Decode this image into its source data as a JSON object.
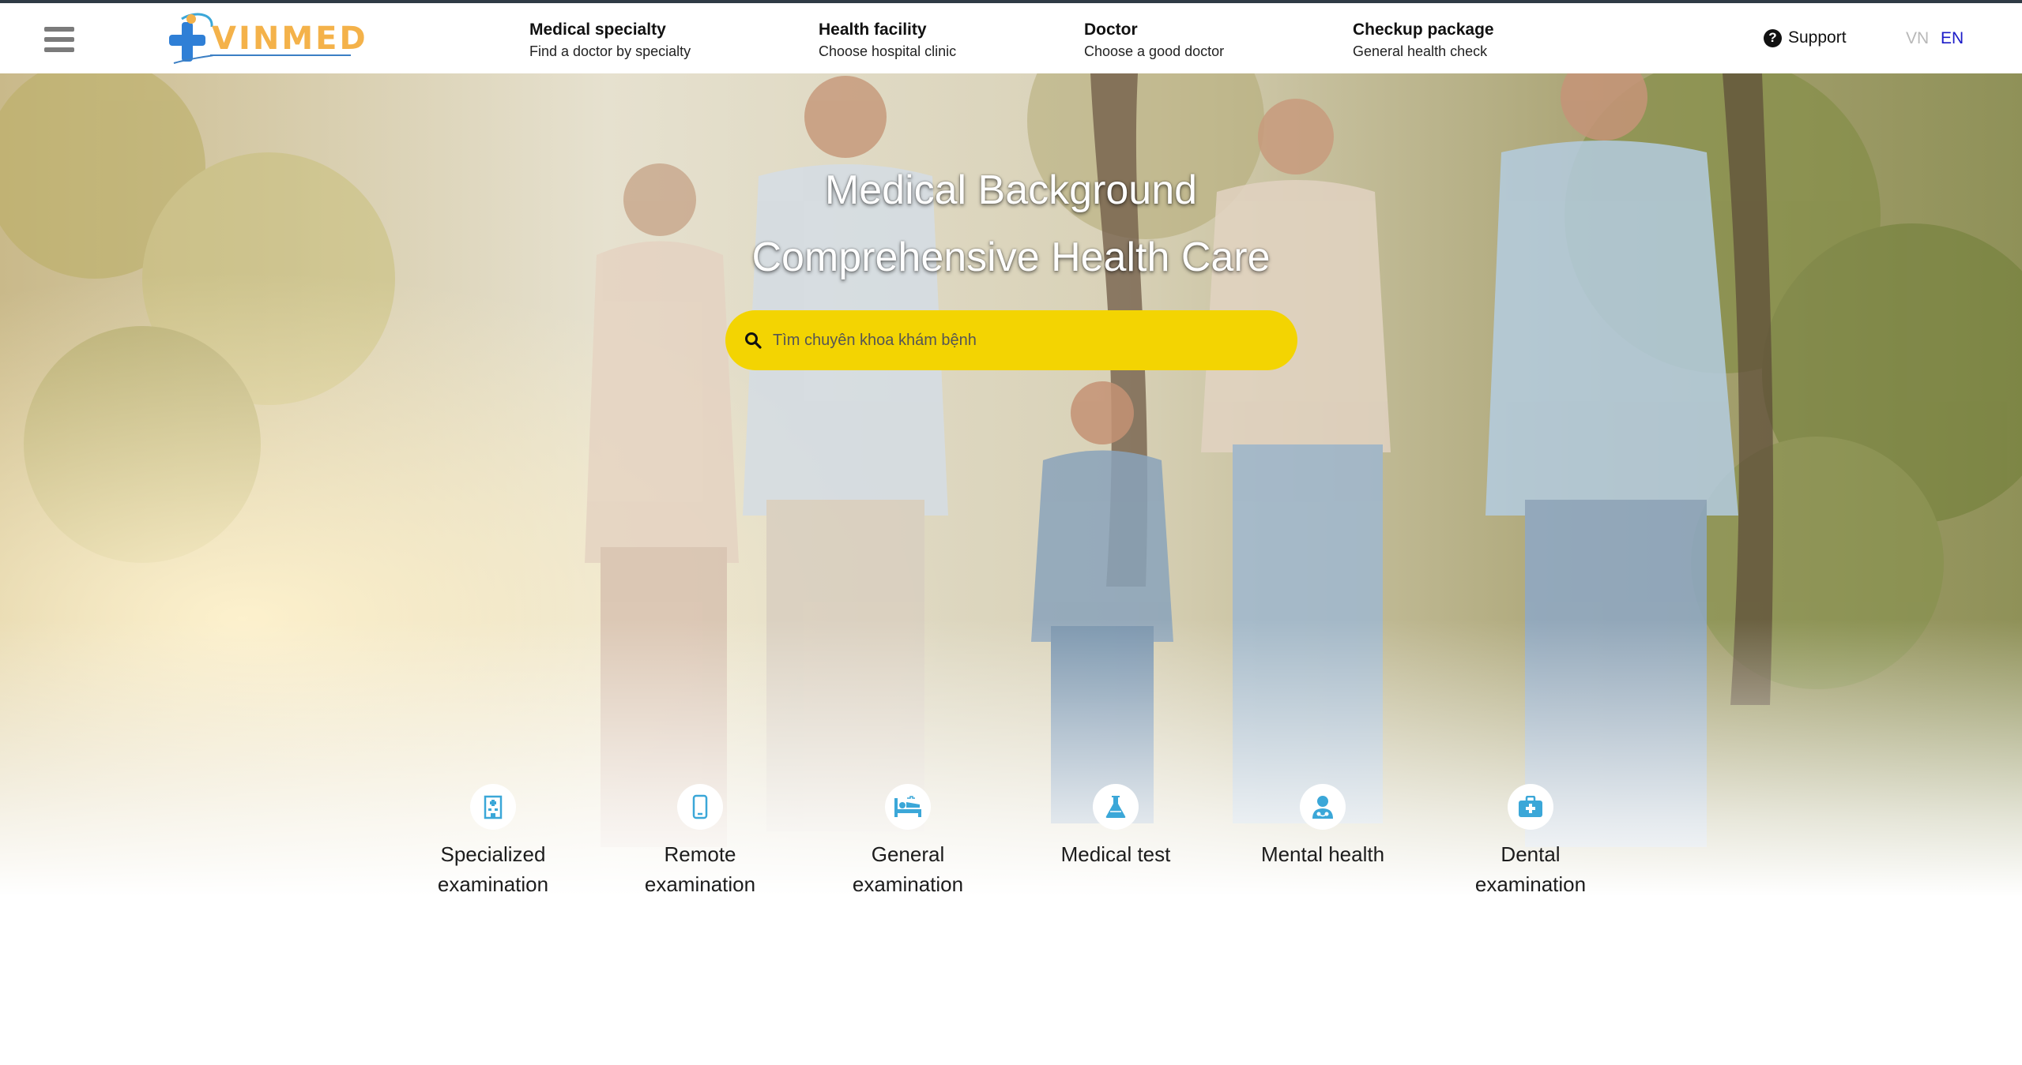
{
  "brand": {
    "name": "VINMED",
    "colors": {
      "accent": "#3ba7d8",
      "logo_text": "#f4b24a",
      "search_bg": "#f3d402",
      "lang_active": "#1a1ac8"
    }
  },
  "nav": [
    {
      "title": "Medical specialty",
      "subtitle": "Find a doctor by specialty"
    },
    {
      "title": "Health facility",
      "subtitle": "Choose hospital clinic"
    },
    {
      "title": "Doctor",
      "subtitle": "Choose a good doctor"
    },
    {
      "title": "Checkup package",
      "subtitle": "General health check"
    }
  ],
  "support": {
    "label": "Support",
    "icon": "question-circle-icon"
  },
  "languages": {
    "vn": "VN",
    "en": "EN",
    "active": "EN"
  },
  "hero": {
    "title_line1": "Medical Background",
    "title_line2": "Comprehensive Health Care",
    "search_placeholder": "Tìm chuyên khoa khám bệnh"
  },
  "services": [
    {
      "label": "Specialized examination",
      "icon": "hospital-building-icon"
    },
    {
      "label": "Remote examination",
      "icon": "mobile-phone-icon"
    },
    {
      "label": "General examination",
      "icon": "hospital-bed-icon"
    },
    {
      "label": "Medical test",
      "icon": "flask-icon"
    },
    {
      "label": "Mental health",
      "icon": "user-doctor-icon"
    },
    {
      "label": "Dental examination",
      "icon": "medical-kit-icon"
    }
  ]
}
